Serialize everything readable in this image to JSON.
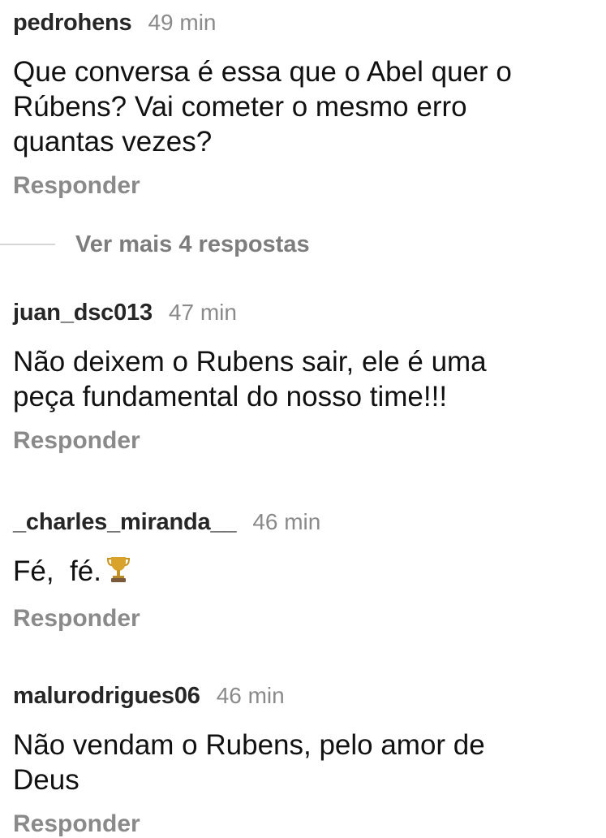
{
  "comments": [
    {
      "username": "pedrohens",
      "time": "49 min",
      "text": "Que conversa é essa que o Abel quer o\nRúbens? Vai cometer o mesmo erro\nquantas vezes?",
      "reply_label": "Responder"
    },
    {
      "username": "juan_dsc013",
      "time": "47 min",
      "text": "Não deixem o Rubens sair, ele é uma\npeça fundamental do nosso time!!!",
      "reply_label": "Responder"
    },
    {
      "username": "_charles_miranda__",
      "time": "46 min",
      "text": "Fé,  fé.",
      "emoji": "trophy-icon",
      "reply_label": "Responder"
    },
    {
      "username": "malurodrigues06",
      "time": "46 min",
      "text": "Não vendam o Rubens, pelo amor de\nDeus",
      "reply_label": "Responder"
    }
  ],
  "more_replies": {
    "label": "Ver mais 4 respostas"
  },
  "colors": {
    "username": "#262626",
    "secondary": "#8a8a8a",
    "divider": "#d6d6d6",
    "trophy": "#c8921e"
  }
}
